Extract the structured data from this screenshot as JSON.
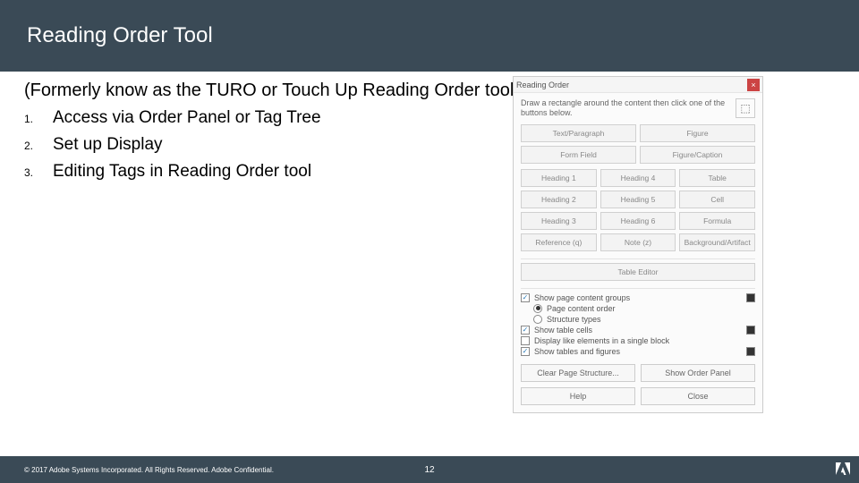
{
  "title": "Reading Order Tool",
  "subtitle": "(Formerly know as the TURO or Touch Up Reading Order tool)",
  "steps": [
    {
      "n": "1.",
      "label": "Access via Order Panel or Tag Tree"
    },
    {
      "n": "2.",
      "label": "Set up Display"
    },
    {
      "n": "3.",
      "label": "Editing Tags in Reading Order tool"
    }
  ],
  "dialog": {
    "title": "Reading Order",
    "close_glyph": "×",
    "instruction": "Draw a rectangle around the content then click one of the buttons below.",
    "icon_glyph": "⬚",
    "row1": {
      "a": "Text/Paragraph",
      "b": "Figure"
    },
    "row2": {
      "a": "Form Field",
      "b": "Figure/Caption"
    },
    "grid": {
      "h1": "Heading 1",
      "h4": "Heading 4",
      "table": "Table",
      "h2": "Heading 2",
      "h5": "Heading 5",
      "cell": "Cell",
      "h3": "Heading 3",
      "h6": "Heading 6",
      "formula": "Formula",
      "ref": "Reference (q)",
      "note": "Note (z)",
      "bg": "Background/Artifact"
    },
    "table_editor": "Table Editor",
    "opts": {
      "show_groups": "Show page content groups",
      "page_order": "Page content order",
      "structure_types": "Structure types",
      "show_table_cells": "Show table cells",
      "display_block": "Display like elements in a single block",
      "show_tf": "Show tables and figures"
    },
    "footer": {
      "clear": "Clear Page Structure...",
      "order": "Show Order Panel",
      "help": "Help",
      "close": "Close"
    }
  },
  "footer": {
    "copyright": "© 2017 Adobe Systems Incorporated. All Rights Reserved. Adobe Confidential.",
    "page": "12"
  }
}
